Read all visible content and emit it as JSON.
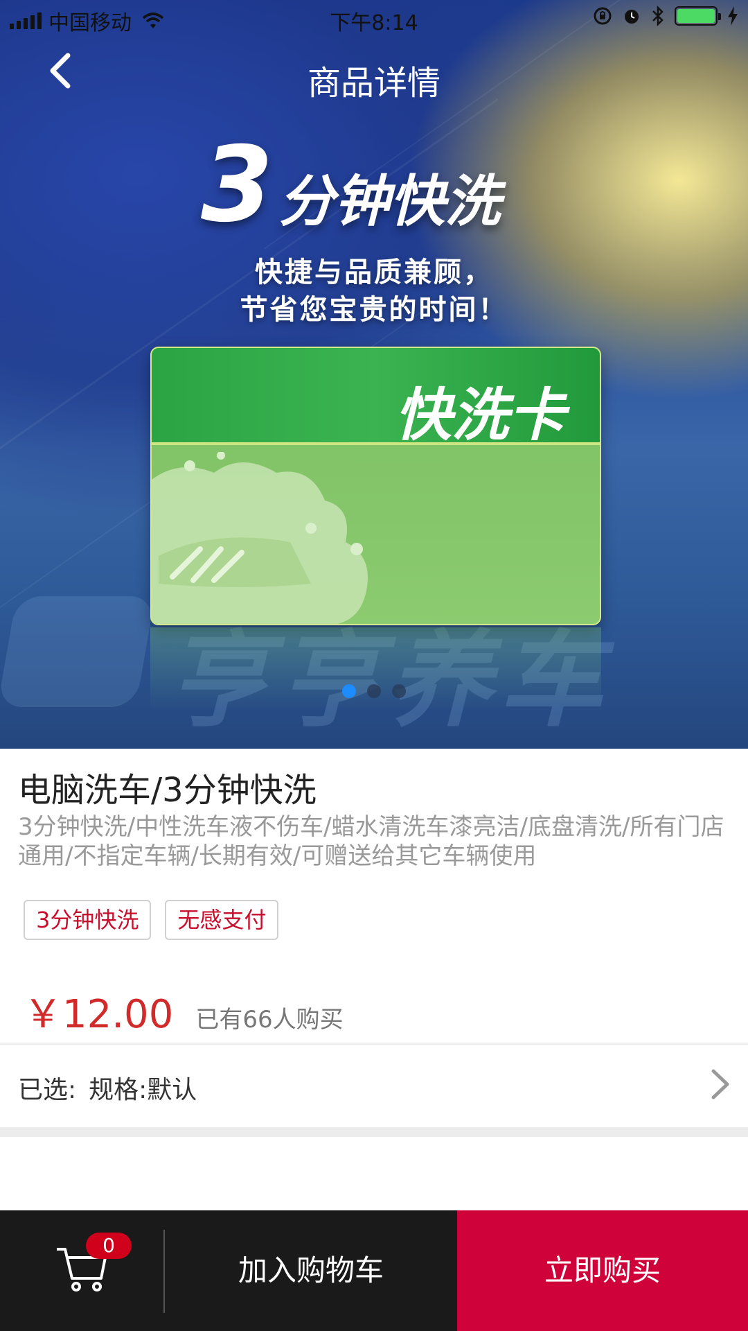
{
  "status_bar": {
    "carrier": "中国移动",
    "time": "下午8:14"
  },
  "nav": {
    "title": "商品详情"
  },
  "banner": {
    "headline_number": "3",
    "headline_text": "分钟快洗",
    "subline_1": "快捷与品质兼顾，",
    "subline_2": "节省您宝贵的时间！",
    "card_label": "快洗卡",
    "watermark": "亨亨养车",
    "slide_count": 3,
    "active_slide": 1
  },
  "product": {
    "name": "电脑洗车/3分钟快洗",
    "description": "3分钟快洗/中性洗车液不伤车/蜡水清洗车漆亮洁/底盘清洗/所有门店通用/不指定车辆/长期有效/可赠送给其它车辆使用",
    "tags": [
      "3分钟快洗",
      "无感支付"
    ],
    "price": "￥12.00",
    "sold_text": "已有66人购买"
  },
  "spec": {
    "label": "已选:",
    "value": "规格:默认"
  },
  "bottom_bar": {
    "cart_count": "0",
    "add_to_cart_label": "加入购物车",
    "buy_now_label": "立即购买"
  },
  "colors": {
    "accent_red": "#d0023a",
    "price_red": "#d12a2a",
    "tag_red": "#c8102e",
    "bar_dark": "#1a1a1a",
    "dot_active": "#1d8cff"
  }
}
